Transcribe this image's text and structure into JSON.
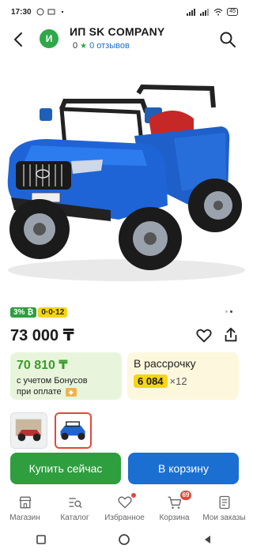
{
  "status_bar": {
    "time": "17:30",
    "battery": "45"
  },
  "header": {
    "shop_initial": "И",
    "shop_name": "ИП SK COMPANY",
    "rating": "0",
    "reviews": "0 отзывов"
  },
  "product": {
    "badge_percent": "3%",
    "badge_installment": "0·0·12",
    "price": "73 000 ₸"
  },
  "bonus": {
    "amount": "70 810 ₸",
    "text_line1": "с учетом Бонусов",
    "text_line2": "при оплате"
  },
  "installment": {
    "title": "В рассрочку",
    "amount": "6 084",
    "multiplier": "×12"
  },
  "actions": {
    "buy_now": "Купить сейчас",
    "add_to_cart": "В корзину"
  },
  "bottom_nav": {
    "items": [
      {
        "label": "Магазин",
        "icon": "store-icon"
      },
      {
        "label": "Каталог",
        "icon": "catalog-icon"
      },
      {
        "label": "Избранное",
        "icon": "heart-icon"
      },
      {
        "label": "Корзина",
        "icon": "cart-icon"
      },
      {
        "label": "Мои заказы",
        "icon": "orders-icon"
      }
    ],
    "cart_count": "69"
  },
  "colors": {
    "green": "#2e9e3e",
    "blue": "#1a6fd1",
    "yellow": "#f5d516",
    "red": "#e5463a"
  }
}
